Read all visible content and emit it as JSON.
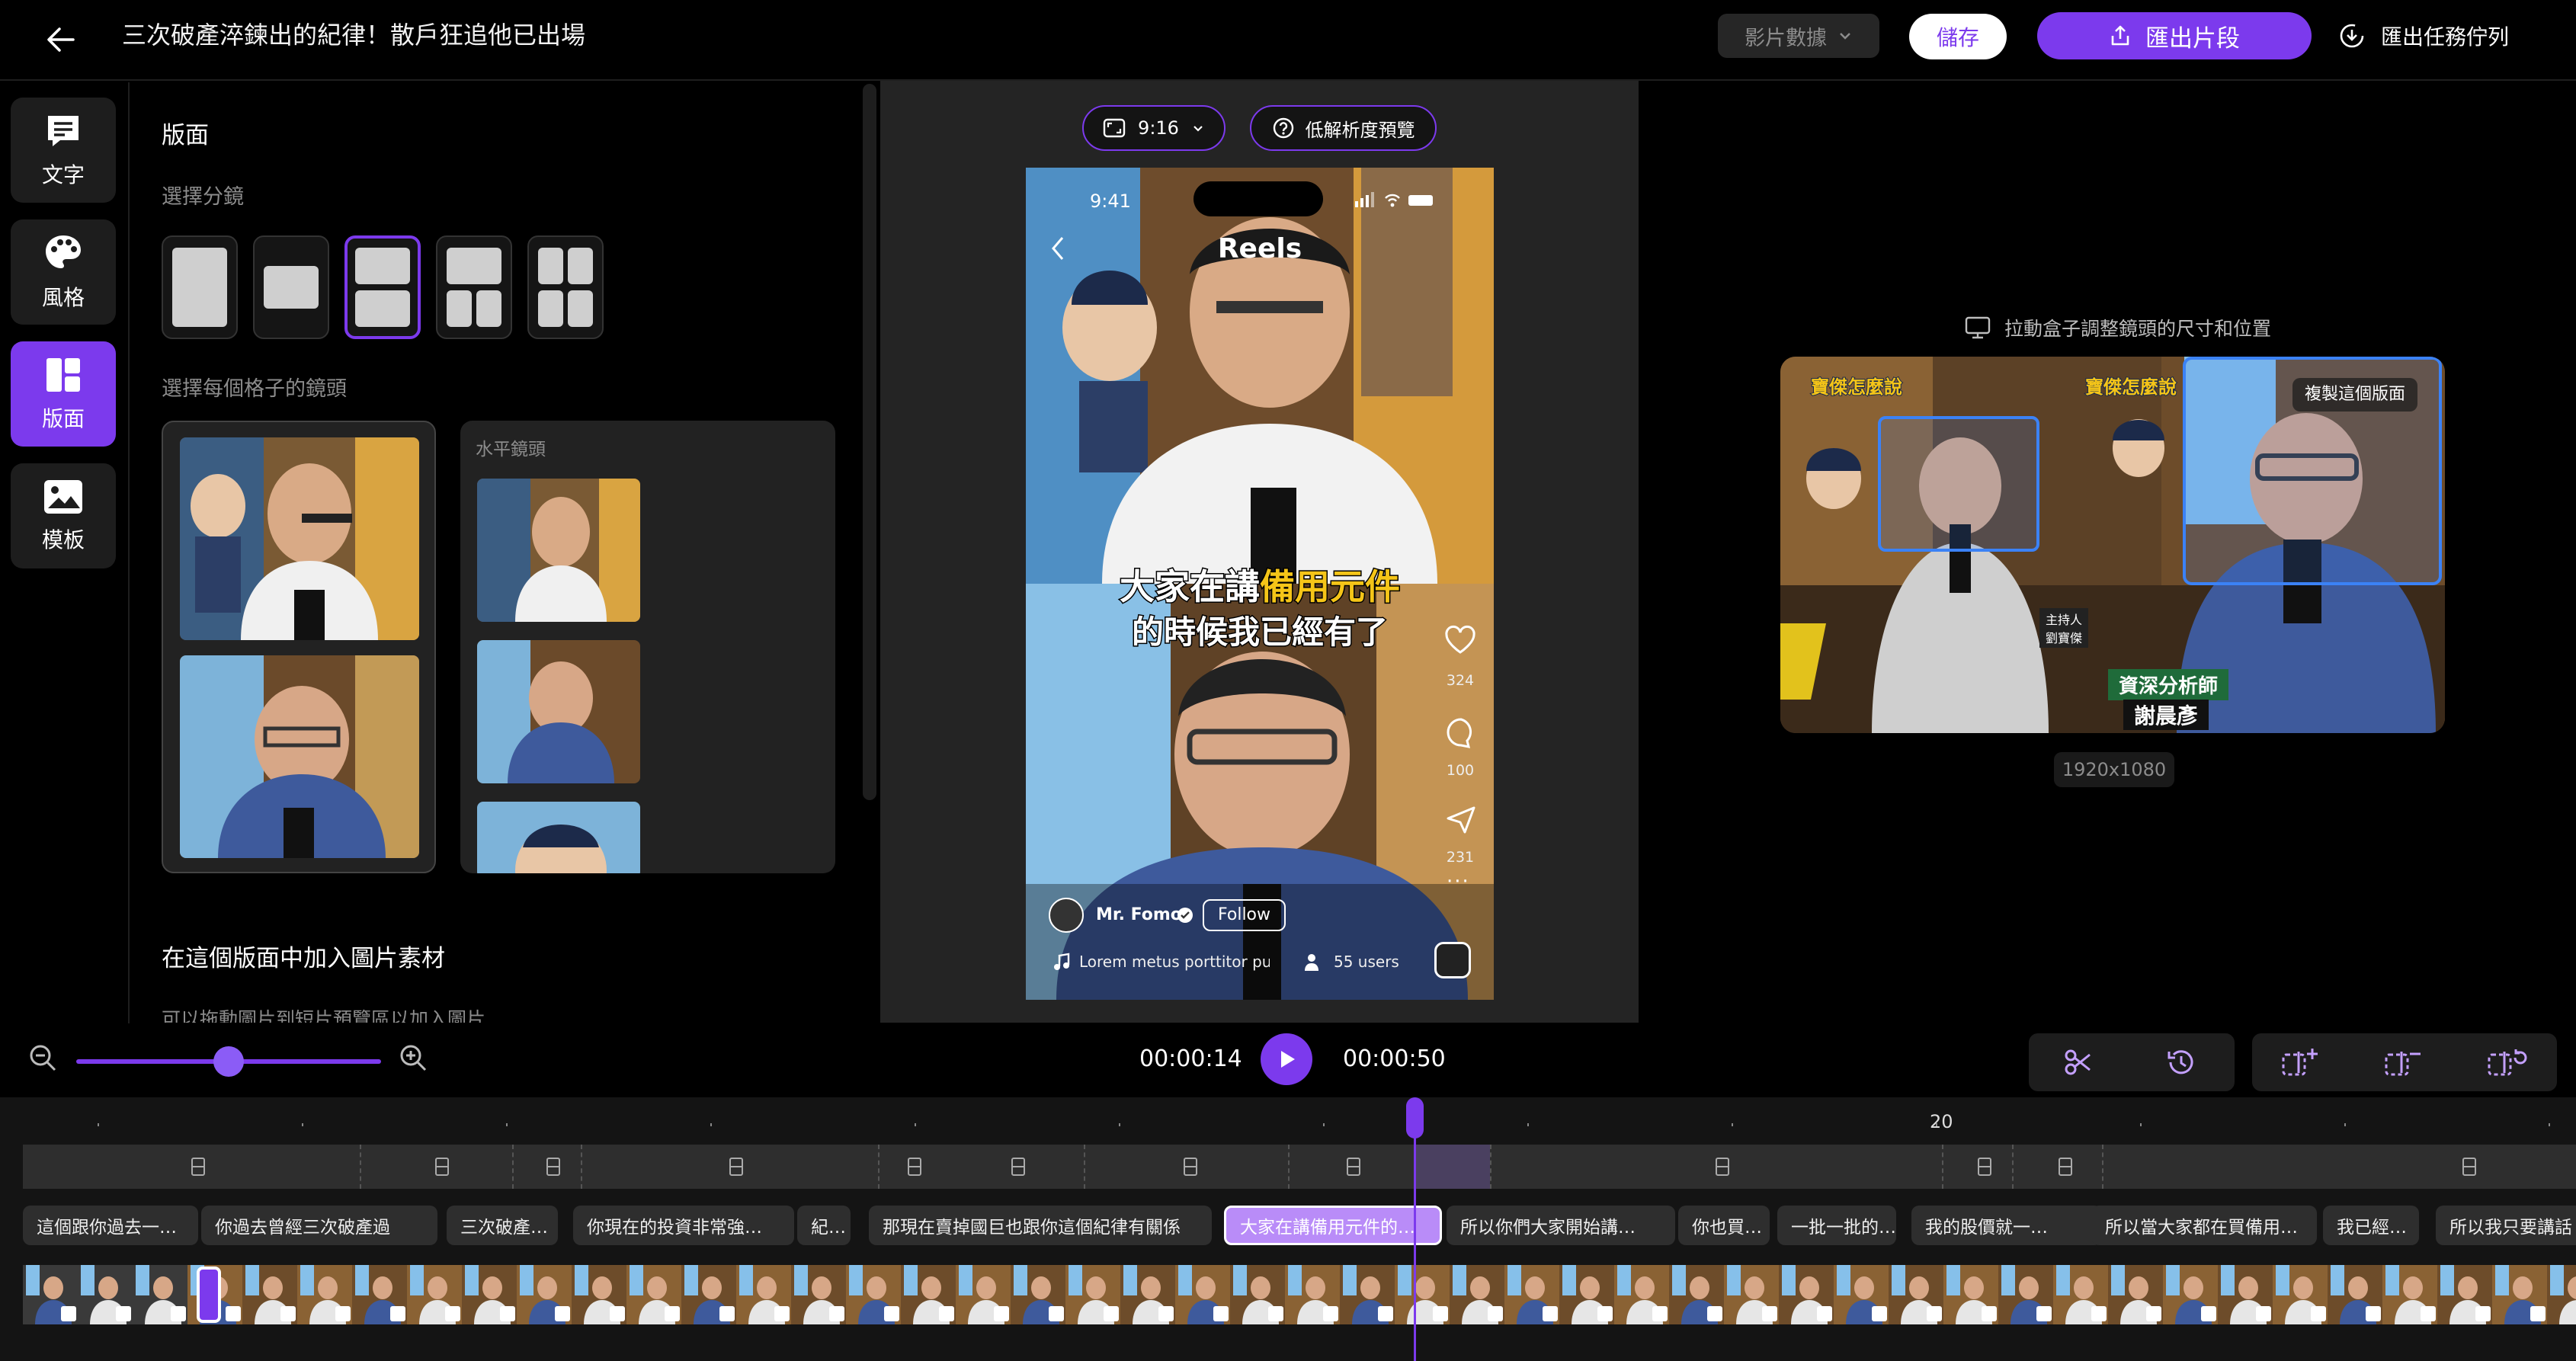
{
  "header": {
    "title": "三次破產淬鍊出的紀律！散戶狂追他已出場",
    "video_data_label": "影片數據",
    "save_label": "儲存",
    "export_label": "匯出片段",
    "queue_label": "匯出任務佇列"
  },
  "rail": {
    "items": [
      {
        "label": "文字",
        "icon": "text-icon"
      },
      {
        "label": "風格",
        "icon": "palette-icon"
      },
      {
        "label": "版面",
        "icon": "layout-icon"
      },
      {
        "label": "模板",
        "icon": "image-icon"
      }
    ],
    "active_index": 2
  },
  "panel": {
    "title": "版面",
    "choose_split_label": "選擇分鏡",
    "choose_shot_label": "選擇每個格子的鏡頭",
    "horizontal_shot_label": "水平鏡頭",
    "add_image_title": "在這個版面中加入圖片素材",
    "add_image_hint": "可以拖動圖片到短片預覽區以加入圖片",
    "selected_layout_index": 2
  },
  "preview": {
    "ratio_label": "9:16",
    "lowres_label": "低解析度預覽",
    "phone": {
      "time": "9:41",
      "app_title": "Reels",
      "caption_line1_normal": "大家在講",
      "caption_line1_highlight": "備用元件",
      "caption_line2": "的時候我已經有了",
      "like_count": "324",
      "comment_count": "100",
      "share_count": "231",
      "user_name": "Mr. Fomo",
      "follow_label": "Follow",
      "music_text": "Lorem metus porttitor pur",
      "users_text": "55 users"
    }
  },
  "source": {
    "drag_hint": "拉動盒子調整鏡頭的尺寸和位置",
    "copy_layout_label": "複製這個版面",
    "lower_third_title": "資深分析師",
    "lower_third_name": "謝晨彥",
    "host_label": "主持人",
    "host_name": "劉寶傑",
    "logo_text": "寶傑怎麼說",
    "resolution": "1920x1080"
  },
  "controls": {
    "current_time": "00:00:14",
    "total_time": "00:00:50",
    "zoom_value": 0.5
  },
  "timeline": {
    "ruler_label": "20",
    "text_chips": [
      "這個跟你過去一…",
      "你過去曾經三次破產過",
      "三次破產…",
      "你現在的投資非常強…",
      "紀…",
      "那現在賣掉國巨也跟你這個紀律有關係",
      "大家在講備用元件的…",
      "所以你們大家開始講…",
      "你也買…",
      "一批一批的…",
      "我的股價就一…",
      "所以當大家都在買備用…",
      "我已經…",
      "所以我只要講話"
    ],
    "active_chip_index": 6
  },
  "colors": {
    "accent": "#7c3aed",
    "active_chip": "#b98cf8",
    "caption_highlight": "#f5c518"
  }
}
